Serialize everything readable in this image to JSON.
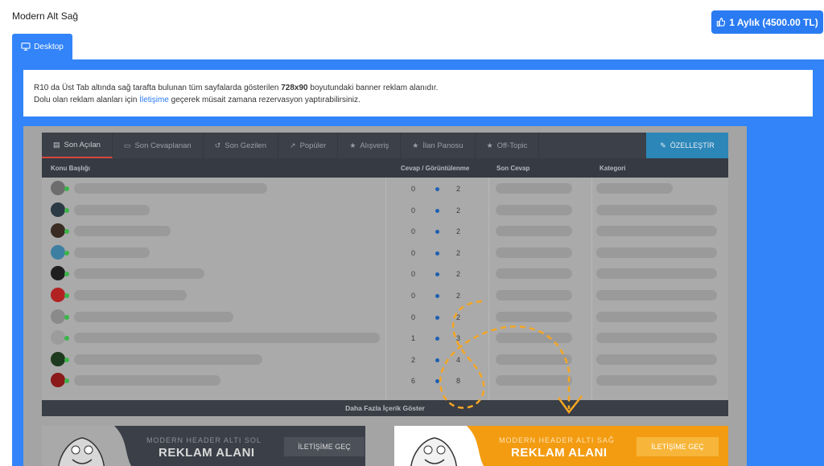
{
  "page": {
    "title": "Modern Alt Sağ"
  },
  "price_button": {
    "label": "1 Aylık (4500.00 TL)",
    "icon": "thumbs-up-icon"
  },
  "tab": {
    "label": "Desktop",
    "icon": "desktop-icon"
  },
  "info": {
    "line1_pre": "R10 da Üst Tab altında sağ tarafta bulunan tüm sayfalarda gösterilen",
    "line1_bold": "728x90",
    "line1_post": "boyutundaki banner reklam alanıdır.",
    "line2_pre": "Dolu olan reklam alanları için",
    "line2_link": "İletişime",
    "line2_post": "geçerek müsait zamana rezervasyon yaptırabilirsiniz."
  },
  "forum": {
    "tabs": [
      {
        "label": "Son Açılan",
        "icon": "document-icon"
      },
      {
        "label": "Son Cevaplanan",
        "icon": "chat-icon"
      },
      {
        "label": "Son Gezilen",
        "icon": "history-icon"
      },
      {
        "label": "Popüler",
        "icon": "trend-icon"
      },
      {
        "label": "Alışveriş",
        "icon": "star-icon"
      },
      {
        "label": "İlan Panosu",
        "icon": "star-icon"
      },
      {
        "label": "Off-Topic",
        "icon": "star-icon"
      }
    ],
    "customize": "ÖZELLEŞTİR",
    "columns": {
      "topic": "Konu Başlığı",
      "stats": "Cevap / Görüntülenme",
      "last": "Son Cevap",
      "category": "Kategori"
    },
    "rows": [
      {
        "replies": "0",
        "views": "2",
        "avatar": "#6d6d6d"
      },
      {
        "replies": "0",
        "views": "2",
        "avatar": "#2b3a44"
      },
      {
        "replies": "0",
        "views": "2",
        "avatar": "#3a2c22"
      },
      {
        "replies": "0",
        "views": "2",
        "avatar": "#3d7fa1"
      },
      {
        "replies": "0",
        "views": "2",
        "avatar": "#1f1f1f"
      },
      {
        "replies": "0",
        "views": "2",
        "avatar": "#b22222"
      },
      {
        "replies": "0",
        "views": "2",
        "avatar": "#8a8a8a"
      },
      {
        "replies": "1",
        "views": "3",
        "avatar": "#9c9c9c"
      },
      {
        "replies": "2",
        "views": "4",
        "avatar": "#1e3a1e"
      },
      {
        "replies": "6",
        "views": "8",
        "avatar": "#8b1a1a"
      }
    ],
    "more": "Daha Fazla İçerik Göster"
  },
  "ads": {
    "left": {
      "sub": "MODERN HEADER ALTI SOL",
      "title": "REKLAM ALANI",
      "button": "İLETİŞİME GEÇ"
    },
    "right": {
      "sub": "MODERN HEADER ALTI SAĞ",
      "title": "REKLAM ALANI",
      "button": "İLETİŞİME GEÇ"
    }
  },
  "colors": {
    "accent": "#3284f8",
    "highlight": "#f39c12",
    "dashed_arrow": "#f5a623"
  }
}
